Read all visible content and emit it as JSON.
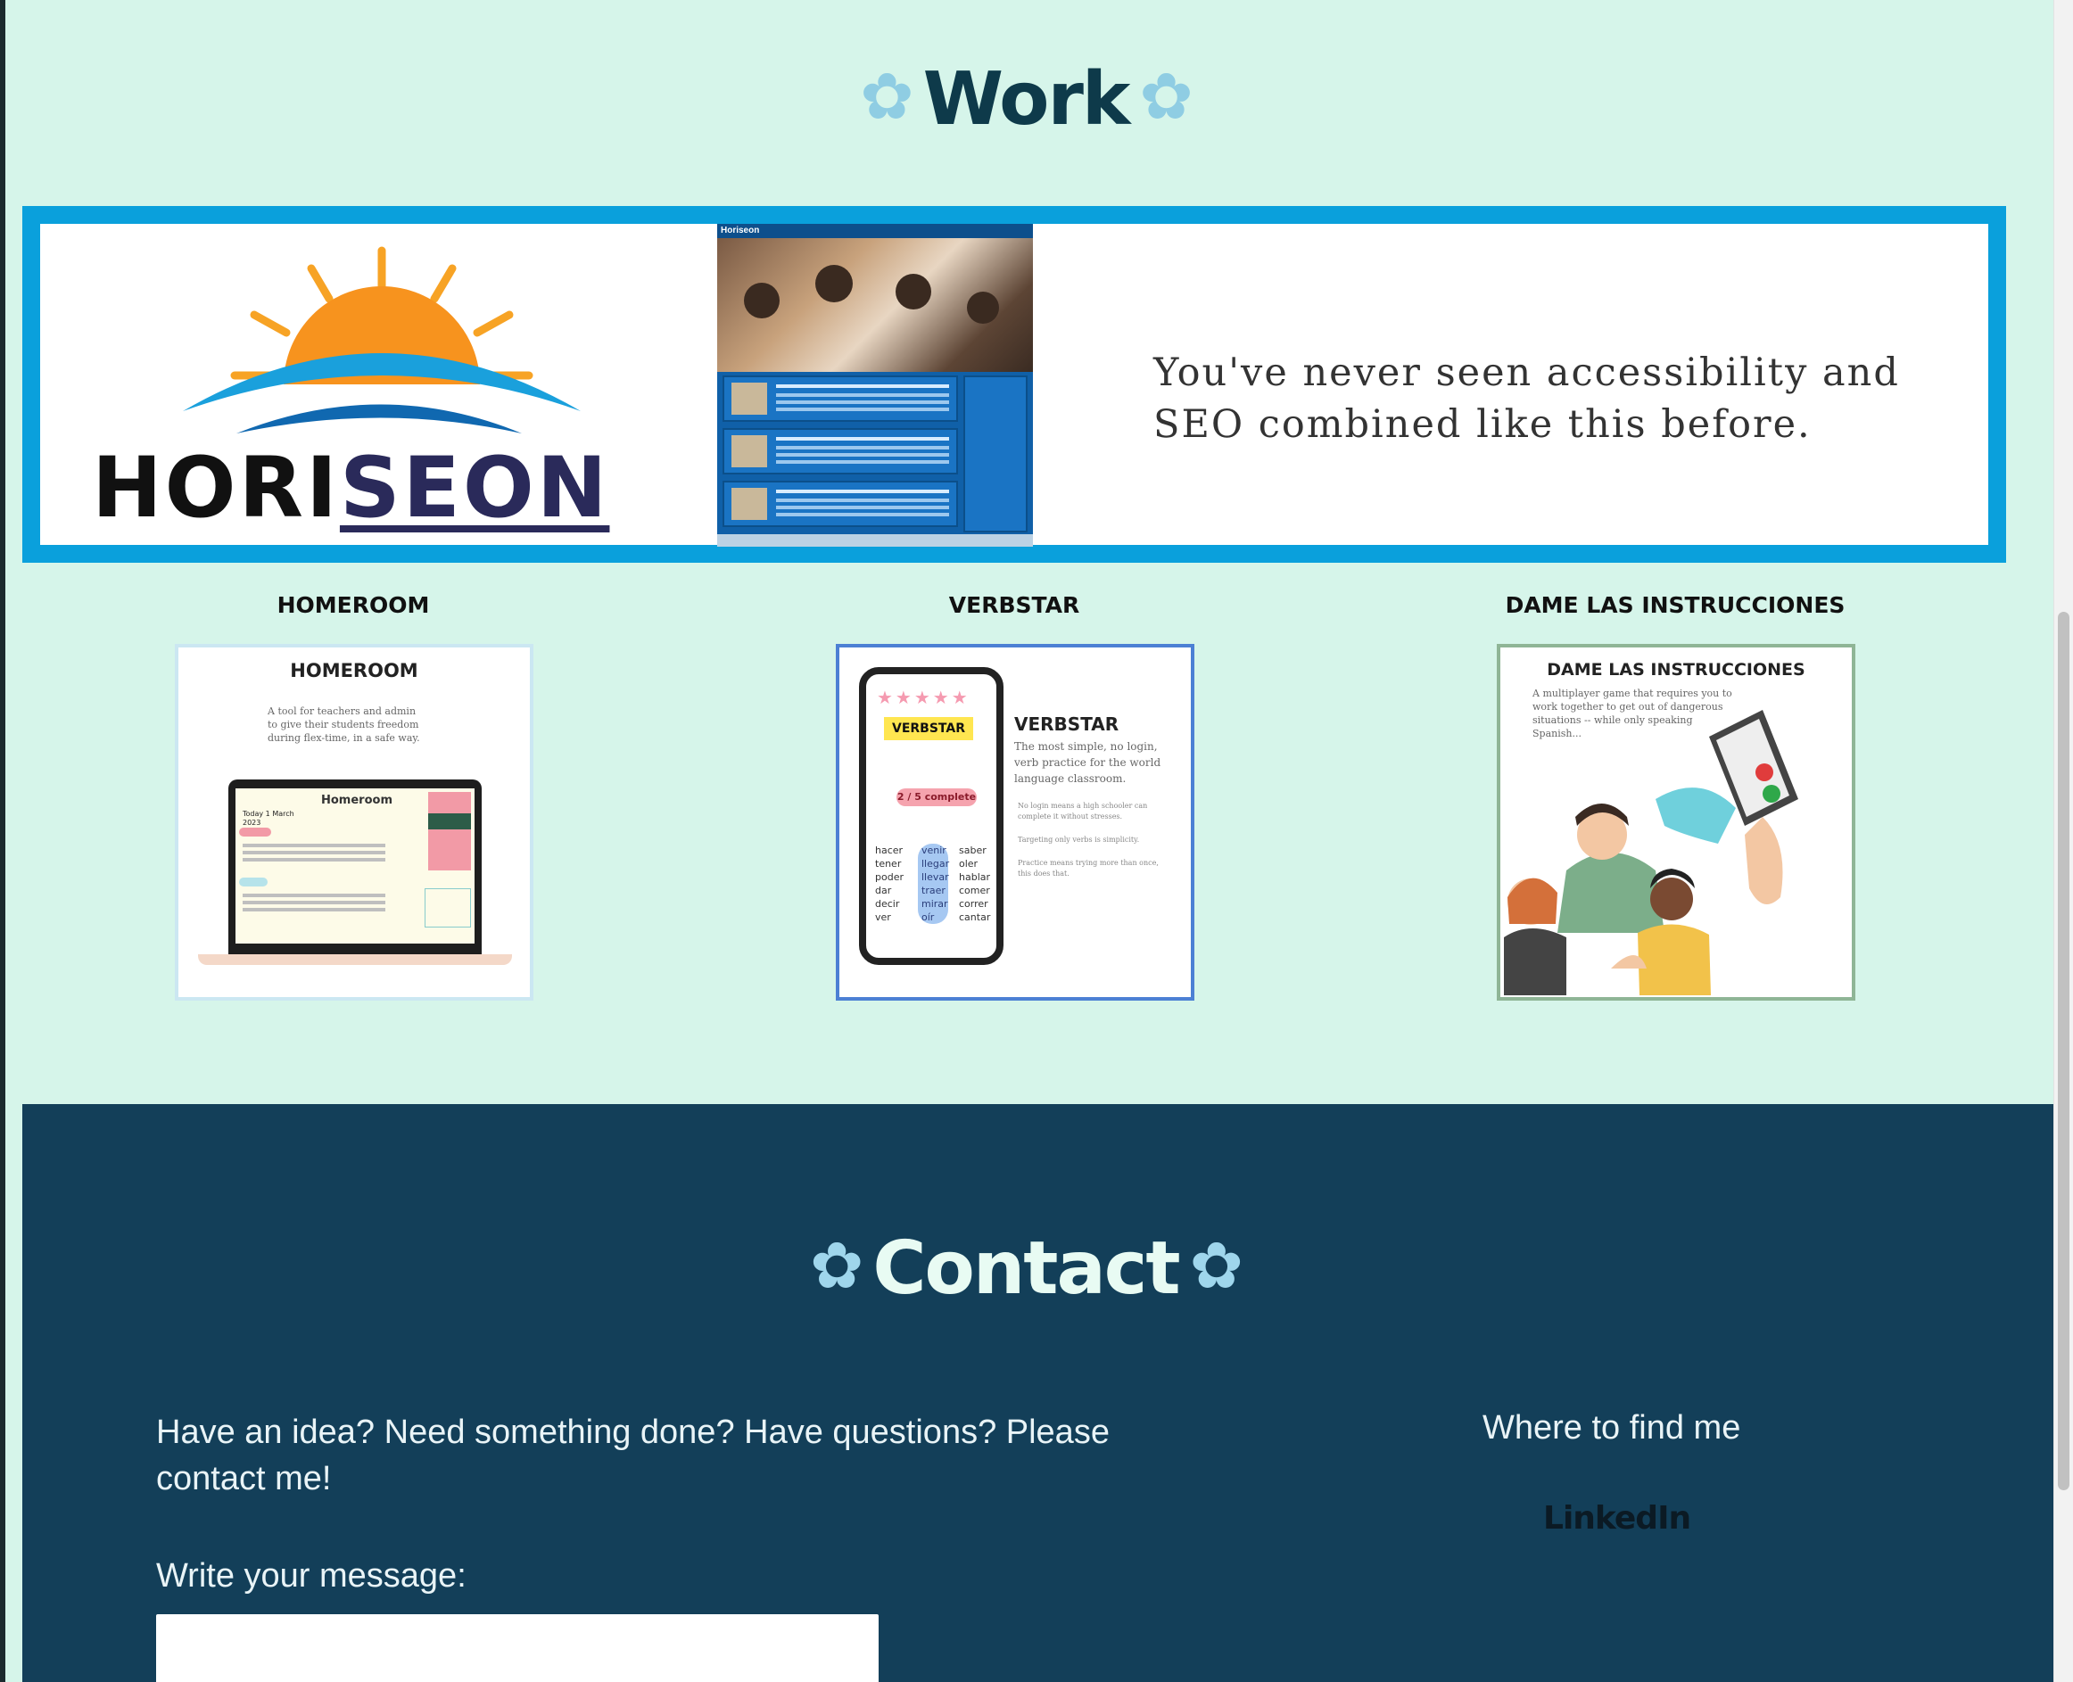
{
  "work": {
    "title": "Work",
    "flower": "✿"
  },
  "featured": {
    "logo_text_a": "HORI",
    "logo_text_b": "SEON",
    "screenshot_brand": "Horiseon",
    "tagline": "You've never seen accessibility and SEO combined like this before."
  },
  "projects": [
    {
      "label": "HOMEROOM",
      "card_title": "HOMEROOM",
      "description": "A tool for teachers and admin to give their students freedom during flex-time, in a safe way.",
      "screen_title": "Homeroom",
      "screen_date": "Today 1 March 2023"
    },
    {
      "label": "VERBSTAR",
      "card_title": "VERBSTAR",
      "badge": "VERBSTAR",
      "progress": "2 / 5 complete",
      "verbs_col1": "hacer tener poder dar decir ver",
      "verbs_col2": "venir llegar llevar traer mirar oír",
      "verbs_col3": "saber oler hablar comer correr cantar",
      "desc": "The most simple, no login, verb practice for the world language classroom.",
      "bullets": [
        "No login means a high schooler can complete it without stresses.",
        "Targeting only verbs is simplicity.",
        "Practice means trying more than once, this does that."
      ]
    },
    {
      "label": "DAME LAS INSTRUCCIONES",
      "card_title": "DAME LAS INSTRUCCIONES",
      "description": "A multiplayer game that requires you to work together to get out of dangerous situations -- while only speaking Spanish..."
    }
  ],
  "contact": {
    "title": "Contact",
    "flower": "✿",
    "intro": "Have an idea? Need something done? Have questions? Please contact me!",
    "message_label": "Write your message:",
    "message_value": "",
    "where_label": "Where to find me",
    "linkedin_label": "LinkedIn"
  },
  "colors": {
    "page_bg": "#d6f5ea",
    "banner_border": "#0aa0dc",
    "contact_bg": "#133f59",
    "heading_dark": "#0e3a4a"
  }
}
